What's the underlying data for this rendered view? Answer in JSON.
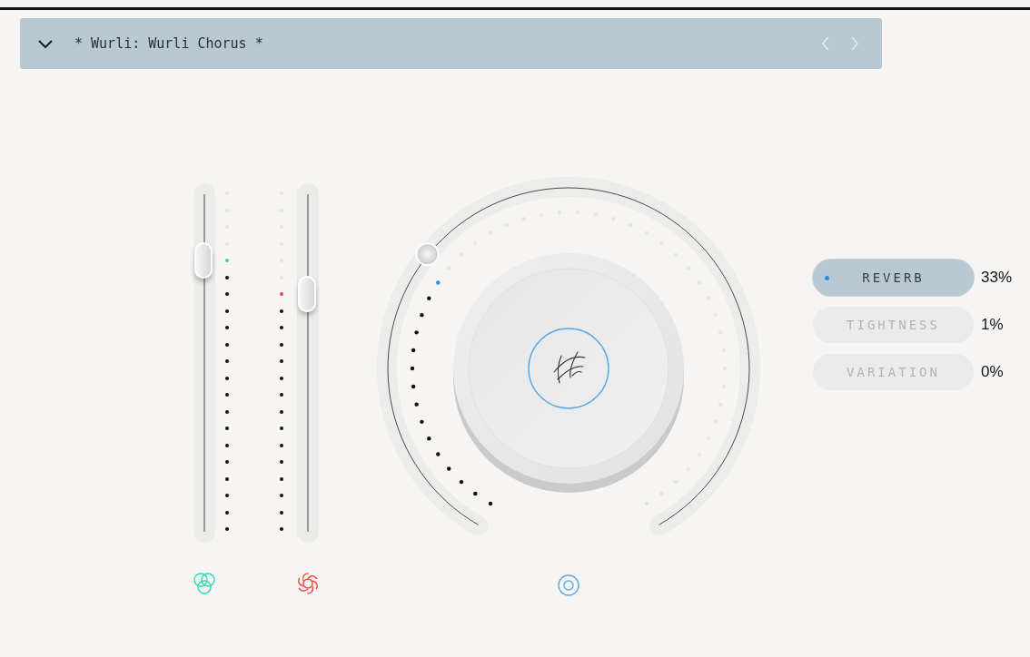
{
  "preset": {
    "title": "* Wurli: Wurli Chorus *"
  },
  "sliders": [
    {
      "kind": "venn",
      "level": 0.8,
      "color": "#2fd9b5"
    },
    {
      "kind": "aperture",
      "level": 0.7,
      "color": "#f0453a"
    }
  ],
  "params": [
    {
      "label": "REVERB",
      "value": "33%",
      "selected": true
    },
    {
      "label": "TIGHTNESS",
      "value": "1%",
      "selected": false
    },
    {
      "label": "VARIATION",
      "value": "0%",
      "selected": false
    }
  ]
}
